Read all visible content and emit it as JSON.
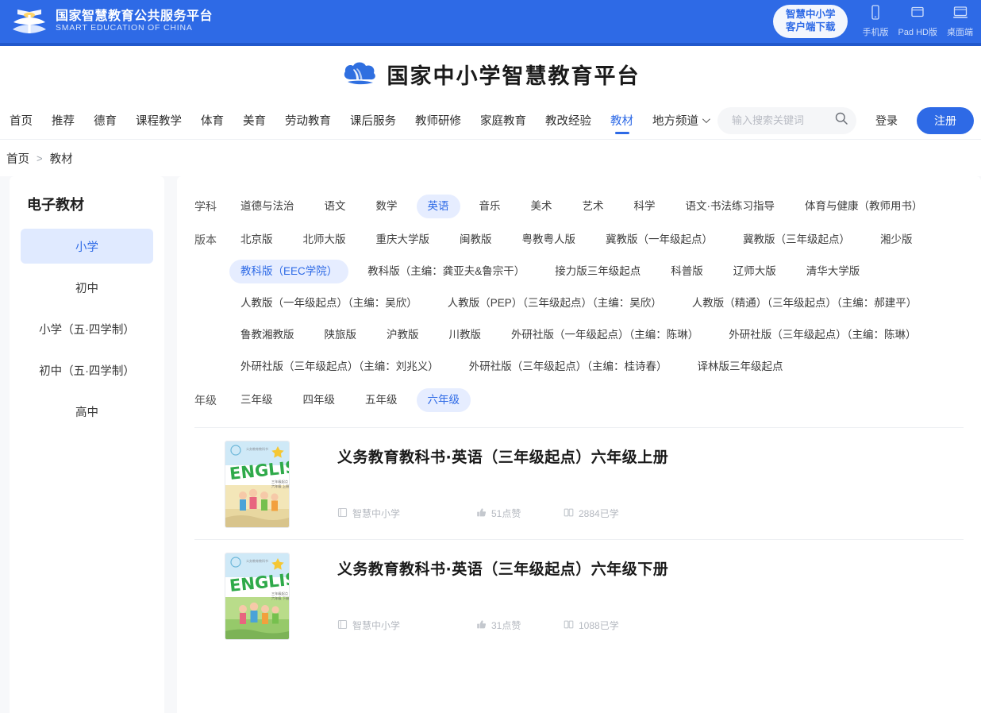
{
  "topbar": {
    "brand_cn": "国家智慧教育公共服务平台",
    "brand_en": "SMART EDUCATION OF CHINA",
    "client_line1": "智慧中小学",
    "client_line2": "客户端下载",
    "devices": [
      {
        "label": "手机版",
        "icon": "phone-icon"
      },
      {
        "label": "Pad HD版",
        "icon": "tablet-icon"
      },
      {
        "label": "桌面端",
        "icon": "desktop-icon"
      }
    ]
  },
  "titleband": {
    "title": "国家中小学智慧教育平台",
    "logo_icon": "cloud-book-logo"
  },
  "nav": {
    "items": [
      {
        "label": "首页",
        "active": false
      },
      {
        "label": "推荐",
        "active": false
      },
      {
        "label": "德育",
        "active": false
      },
      {
        "label": "课程教学",
        "active": false
      },
      {
        "label": "体育",
        "active": false
      },
      {
        "label": "美育",
        "active": false
      },
      {
        "label": "劳动教育",
        "active": false
      },
      {
        "label": "课后服务",
        "active": false
      },
      {
        "label": "教师研修",
        "active": false
      },
      {
        "label": "家庭教育",
        "active": false
      },
      {
        "label": "教改经验",
        "active": false
      },
      {
        "label": "教材",
        "active": true
      },
      {
        "label": "地方频道",
        "active": false,
        "has_chevron": true
      }
    ],
    "search_placeholder": "输入搜索关键词",
    "search_value": "",
    "login_label": "登录",
    "register_label": "注册"
  },
  "breadcrumb": {
    "home": "首页",
    "separator": ">",
    "current": "教材"
  },
  "sidebar": {
    "title": "电子教材",
    "items": [
      {
        "label": "小学",
        "active": true
      },
      {
        "label": "初中",
        "active": false
      },
      {
        "label": "小学（五·四学制）",
        "active": false
      },
      {
        "label": "初中（五·四学制）",
        "active": false
      },
      {
        "label": "高中",
        "active": false
      }
    ]
  },
  "filters": [
    {
      "label": "学科",
      "rows": [
        [
          {
            "label": "道德与法治",
            "active": false
          },
          {
            "label": "语文",
            "active": false
          },
          {
            "label": "数学",
            "active": false
          },
          {
            "label": "英语",
            "active": true
          },
          {
            "label": "音乐",
            "active": false
          },
          {
            "label": "美术",
            "active": false
          },
          {
            "label": "艺术",
            "active": false
          },
          {
            "label": "科学",
            "active": false
          },
          {
            "label": "语文·书法练习指导",
            "active": false
          },
          {
            "label": "体育与健康（教师用书）",
            "active": false
          }
        ]
      ]
    },
    {
      "label": "版本",
      "rows": [
        [
          {
            "label": "北京版",
            "active": false
          },
          {
            "label": "北师大版",
            "active": false
          },
          {
            "label": "重庆大学版",
            "active": false
          },
          {
            "label": "闽教版",
            "active": false
          },
          {
            "label": "粤教粤人版",
            "active": false
          },
          {
            "label": "冀教版（一年级起点）",
            "active": false
          },
          {
            "label": "冀教版（三年级起点）",
            "active": false
          },
          {
            "label": "湘少版",
            "active": false
          },
          {
            "label": "教科版（EEC学院）",
            "active": true
          },
          {
            "label": "教科版（主编：龚亚夫&鲁宗干）",
            "active": false
          },
          {
            "label": "接力版三年级起点",
            "active": false
          },
          {
            "label": "科普版",
            "active": false
          },
          {
            "label": "辽师大版",
            "active": false
          },
          {
            "label": "清华大学版",
            "active": false
          },
          {
            "label": "人教版（一年级起点）（主编：吴欣）",
            "active": false
          },
          {
            "label": "人教版（PEP）（三年级起点）（主编：吴欣）",
            "active": false
          },
          {
            "label": "人教版（精通）（三年级起点）（主编：郝建平）",
            "active": false
          },
          {
            "label": "鲁教湘教版",
            "active": false
          },
          {
            "label": "陕旅版",
            "active": false
          },
          {
            "label": "沪教版",
            "active": false
          },
          {
            "label": "川教版",
            "active": false
          },
          {
            "label": "外研社版（一年级起点）（主编：陈琳）",
            "active": false
          },
          {
            "label": "外研社版（三年级起点）（主编：陈琳）",
            "active": false
          },
          {
            "label": "外研社版（三年级起点）（主编：刘兆义）",
            "active": false
          },
          {
            "label": "外研社版（三年级起点）（主编：桂诗春）",
            "active": false
          },
          {
            "label": "译林版三年级起点",
            "active": false
          }
        ]
      ]
    },
    {
      "label": "年级",
      "rows": [
        [
          {
            "label": "三年级",
            "active": false
          },
          {
            "label": "四年级",
            "active": false
          },
          {
            "label": "五年级",
            "active": false
          },
          {
            "label": "六年级",
            "active": true
          }
        ]
      ]
    }
  ],
  "books": [
    {
      "title": "义务教育教科书·英语（三年级起点）六年级上册",
      "source": "智慧中小学",
      "likes": "51点赞",
      "studied": "2884已学",
      "cover_season": "autumn"
    },
    {
      "title": "义务教育教科书·英语（三年级起点）六年级下册",
      "source": "智慧中小学",
      "likes": "31点赞",
      "studied": "1088已学",
      "cover_season": "spring"
    }
  ],
  "colors": {
    "brand_blue": "#2e6ae6",
    "chip_active_bg": "#e6edff",
    "sidebar_active_bg": "#e0eaff",
    "page_bg": "#f7f8fa"
  }
}
